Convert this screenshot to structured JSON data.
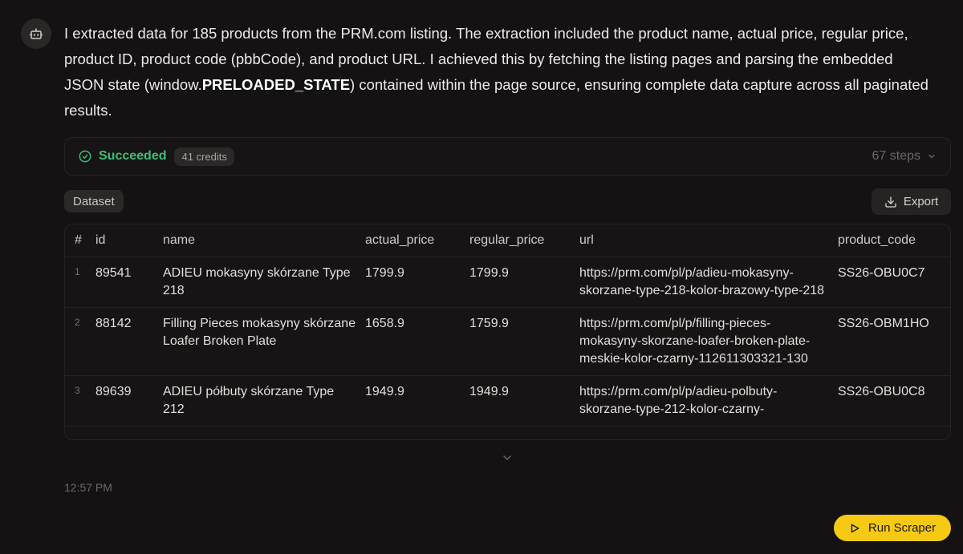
{
  "assistant_message": {
    "text_before": "I extracted data for 185 products from the PRM.com listing. The extraction included the product name, actual price, regular price, product ID, product code (pbbCode), and product URL. I achieved this by fetching the listing pages and parsing the embedded JSON state (window.",
    "bold": "PRELOADED_STATE",
    "text_after": ") contained within the page source, ensuring complete data capture across all paginated results."
  },
  "status": {
    "label": "Succeeded",
    "credits": "41 credits",
    "steps": "67 steps",
    "color": "#3fbf7a"
  },
  "dataset_tab": "Dataset",
  "export_label": "Export",
  "table": {
    "columns": [
      "#",
      "id",
      "name",
      "actual_price",
      "regular_price",
      "url",
      "product_code"
    ],
    "rows": [
      {
        "index": "1",
        "id": "89541",
        "name": "ADIEU mokasyny skórzane Type 218",
        "actual_price": "1799.9",
        "regular_price": "1799.9",
        "url": "https://prm.com/pl/p/adieu-mokasyny-skorzane-type-218-kolor-brazowy-type-218",
        "product_code": "SS26-OBU0C7"
      },
      {
        "index": "2",
        "id": "88142",
        "name": "Filling Pieces mokasyny skórzane Loafer Broken Plate",
        "actual_price": "1658.9",
        "regular_price": "1759.9",
        "url": "https://prm.com/pl/p/filling-pieces-mokasyny-skorzane-loafer-broken-plate-meskie-kolor-czarny-112611303321-130",
        "product_code": "SS26-OBM1HO"
      },
      {
        "index": "3",
        "id": "89639",
        "name": "ADIEU półbuty skórzane Type 212",
        "actual_price": "1949.9",
        "regular_price": "1949.9",
        "url": "https://prm.com/pl/p/adieu-polbuty-skorzane-type-212-kolor-czarny-",
        "product_code": "SS26-OBU0C8"
      }
    ]
  },
  "timestamp": "12:57 PM",
  "run_button": {
    "label": "Run Scraper",
    "color": "#f6c915"
  }
}
